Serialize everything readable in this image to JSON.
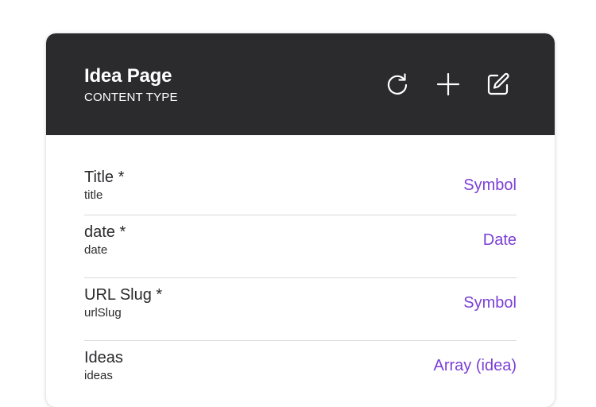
{
  "header": {
    "title": "Idea Page",
    "subtitle": "CONTENT TYPE",
    "actions": {
      "refresh_icon": "refresh-icon",
      "add_icon": "plus-icon",
      "edit_icon": "edit-icon"
    },
    "background_color": "#2b2a2d"
  },
  "fields": [
    {
      "name": "Title *",
      "id": "title",
      "type": "Symbol"
    },
    {
      "name": "date *",
      "id": "date",
      "type": "Date"
    },
    {
      "name": "URL Slug *",
      "id": "urlSlug",
      "type": "Symbol"
    },
    {
      "name": "Ideas",
      "id": "ideas",
      "type": "Array (idea)"
    }
  ],
  "colors": {
    "type_accent": "#7b3fd6",
    "text": "#2b2a2d",
    "divider": "#d9d9de"
  }
}
